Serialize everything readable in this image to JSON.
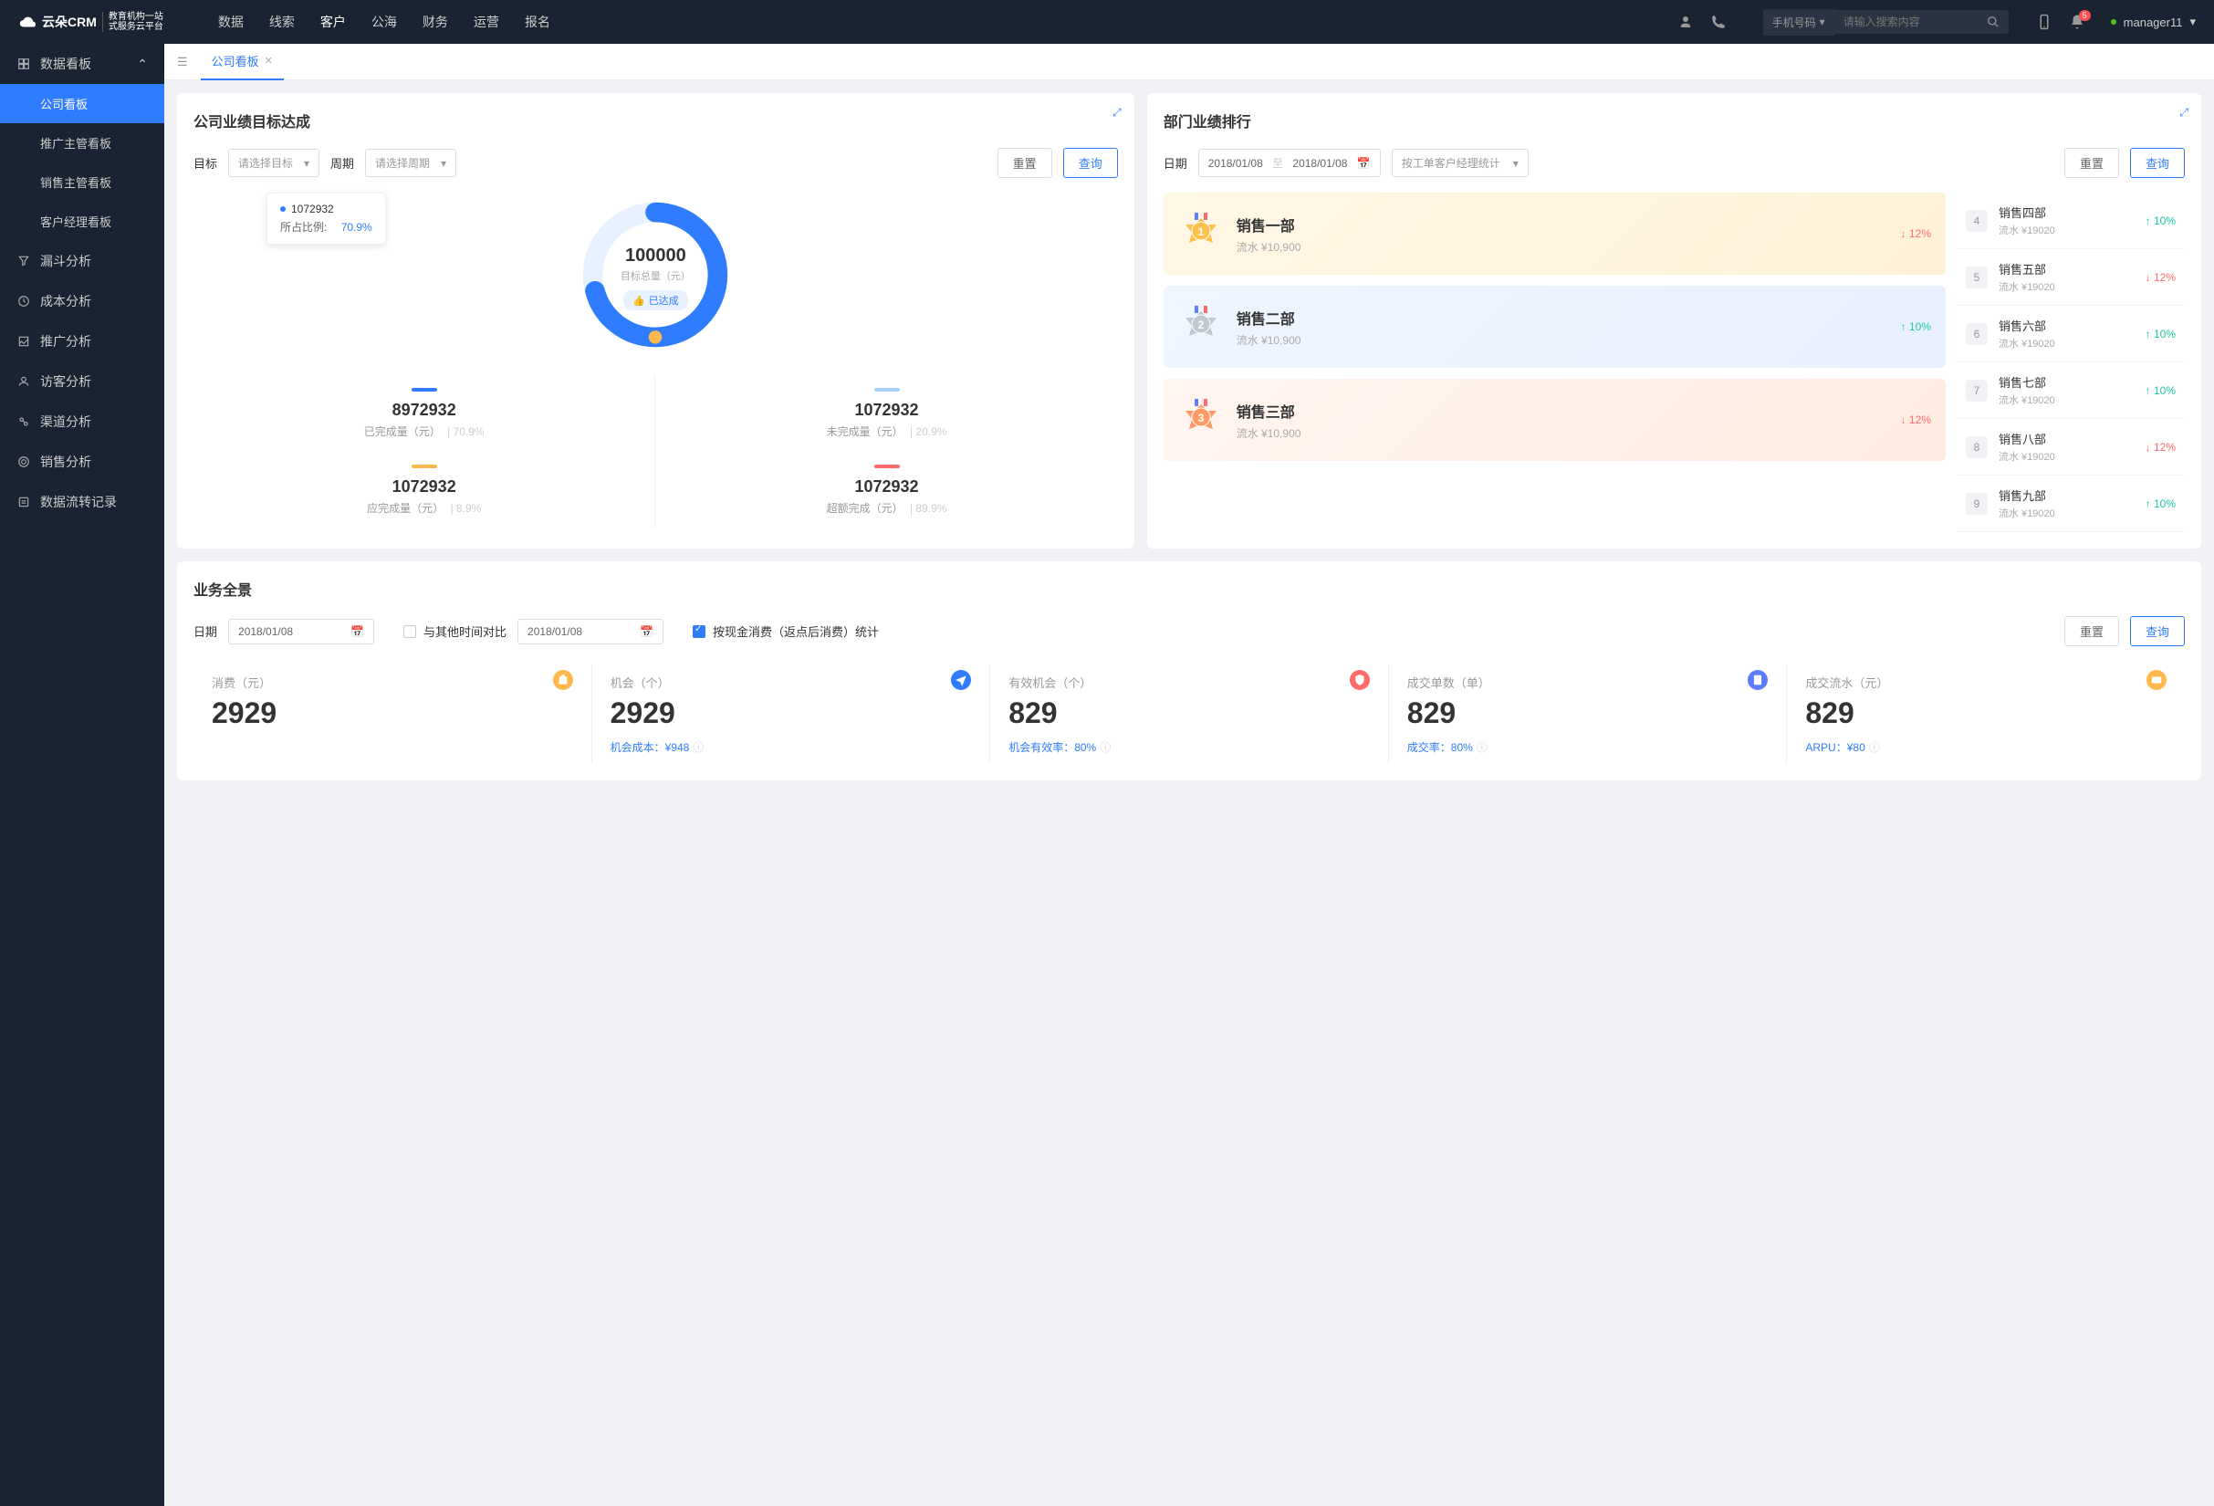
{
  "logo": {
    "main": "云朵CRM",
    "sub1": "教育机构一站",
    "sub2": "式服务云平台"
  },
  "topnav": [
    "数据",
    "线索",
    "客户",
    "公海",
    "财务",
    "运营",
    "报名"
  ],
  "search": {
    "type": "手机号码",
    "placeholder": "请输入搜索内容"
  },
  "notify_count": "5",
  "user": "manager11",
  "sidebar": {
    "header": "数据看板",
    "subs": [
      "公司看板",
      "推广主管看板",
      "销售主管看板",
      "客户经理看板"
    ],
    "items": [
      "漏斗分析",
      "成本分析",
      "推广分析",
      "访客分析",
      "渠道分析",
      "销售分析",
      "数据流转记录"
    ]
  },
  "tab": {
    "label": "公司看板"
  },
  "target": {
    "title": "公司业绩目标达成",
    "goal_label": "目标",
    "goal_ph": "请选择目标",
    "period_label": "周期",
    "period_ph": "请选择周期",
    "reset": "重置",
    "query": "查询",
    "tooltip_val": "1072932",
    "tooltip_label": "所占比例:",
    "tooltip_pct": "70.9%",
    "center_num": "100000",
    "center_sub": "目标总量（元）",
    "badge": "已达成",
    "metrics": [
      {
        "color": "#2f7cff",
        "num": "8972932",
        "label": "已完成量（元）",
        "pct": "70.9%"
      },
      {
        "color": "#a8cfff",
        "num": "1072932",
        "label": "未完成量（元）",
        "pct": "20.9%"
      },
      {
        "color": "#ffb84d",
        "num": "1072932",
        "label": "应完成量（元）",
        "pct": "8.9%"
      },
      {
        "color": "#ff6b6b",
        "num": "1072932",
        "label": "超额完成（元）",
        "pct": "89.9%"
      }
    ]
  },
  "rank": {
    "title": "部门业绩排行",
    "date_label": "日期",
    "date_from": "2018/01/08",
    "date_sep": "至",
    "date_to": "2018/01/08",
    "mode": "按工单客户经理统计",
    "reset": "重置",
    "query": "查询",
    "podium": [
      {
        "rank": "1",
        "name": "销售一部",
        "sub": "流水 ¥10,900",
        "delta": "12%",
        "dir": "down"
      },
      {
        "rank": "2",
        "name": "销售二部",
        "sub": "流水 ¥10,900",
        "delta": "10%",
        "dir": "up"
      },
      {
        "rank": "3",
        "name": "销售三部",
        "sub": "流水 ¥10,900",
        "delta": "12%",
        "dir": "down"
      }
    ],
    "list": [
      {
        "n": "4",
        "name": "销售四部",
        "sub": "流水 ¥19020",
        "delta": "10%",
        "dir": "up"
      },
      {
        "n": "5",
        "name": "销售五部",
        "sub": "流水 ¥19020",
        "delta": "12%",
        "dir": "down"
      },
      {
        "n": "6",
        "name": "销售六部",
        "sub": "流水 ¥19020",
        "delta": "10%",
        "dir": "up"
      },
      {
        "n": "7",
        "name": "销售七部",
        "sub": "流水 ¥19020",
        "delta": "10%",
        "dir": "up"
      },
      {
        "n": "8",
        "name": "销售八部",
        "sub": "流水 ¥19020",
        "delta": "12%",
        "dir": "down"
      },
      {
        "n": "9",
        "name": "销售九部",
        "sub": "流水 ¥19020",
        "delta": "10%",
        "dir": "up"
      }
    ]
  },
  "biz": {
    "title": "业务全景",
    "date_label": "日期",
    "date1": "2018/01/08",
    "compare_label": "与其他时间对比",
    "date2": "2018/01/08",
    "checkbox_label": "按现金消费（返点后消费）统计",
    "reset": "重置",
    "query": "查询",
    "cards": [
      {
        "label": "消费（元）",
        "num": "2929",
        "sub": "",
        "color": "#ffb84d",
        "icon": "bag"
      },
      {
        "label": "机会（个）",
        "num": "2929",
        "sub": "机会成本：¥948",
        "color": "#2f7cff",
        "icon": "plane"
      },
      {
        "label": "有效机会（个）",
        "num": "829",
        "sub": "机会有效率：80%",
        "color": "#ff6b6b",
        "icon": "shield"
      },
      {
        "label": "成交单数（单）",
        "num": "829",
        "sub": "成交率：80%",
        "color": "#5c7cff",
        "icon": "doc"
      },
      {
        "label": "成交流水（元）",
        "num": "829",
        "sub": "ARPU：¥80",
        "color": "#ffb84d",
        "icon": "card"
      }
    ]
  },
  "chart_data": {
    "type": "pie",
    "title": "公司业绩目标达成",
    "total_target": 100000,
    "series": [
      {
        "name": "已完成量（元）",
        "value": 8972932,
        "pct": 70.9,
        "color": "#2f7cff"
      },
      {
        "name": "未完成量（元）",
        "value": 1072932,
        "pct": 20.9,
        "color": "#a8cfff"
      },
      {
        "name": "应完成量（元）",
        "value": 1072932,
        "pct": 8.9,
        "color": "#ffb84d"
      },
      {
        "name": "超额完成（元）",
        "value": 1072932,
        "pct": 89.9,
        "color": "#ff6b6b"
      }
    ]
  }
}
